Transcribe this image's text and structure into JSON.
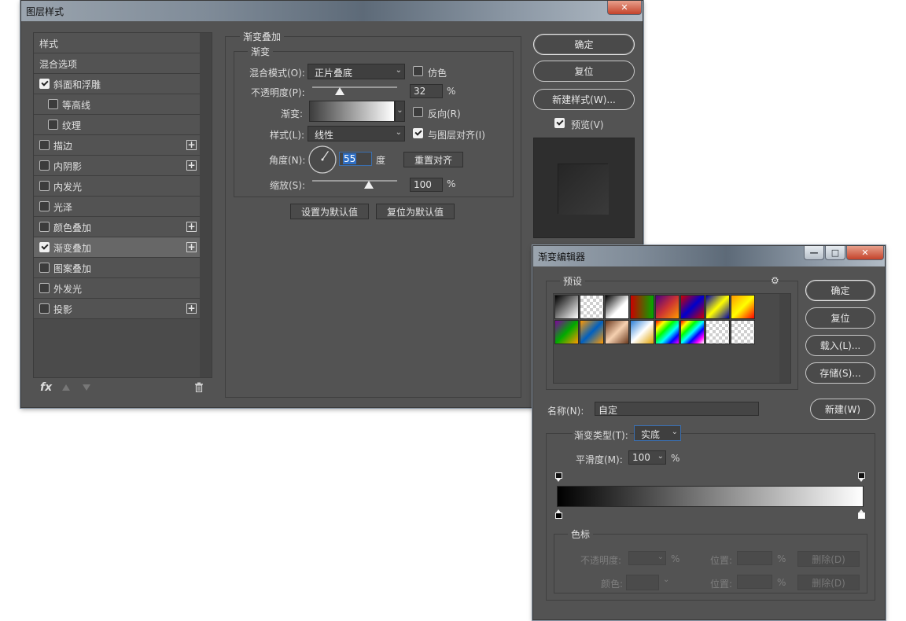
{
  "layer_style": {
    "title": "图层样式",
    "close_glyph": "✕",
    "styles": [
      {
        "label": "样式",
        "checkbox": false,
        "checked": false,
        "indent": false,
        "plus": false,
        "active": false
      },
      {
        "label": "混合选项",
        "checkbox": false,
        "checked": false,
        "indent": false,
        "plus": false,
        "active": false
      },
      {
        "label": "斜面和浮雕",
        "checkbox": true,
        "checked": true,
        "indent": false,
        "plus": false,
        "active": false
      },
      {
        "label": "等高线",
        "checkbox": true,
        "checked": false,
        "indent": true,
        "plus": false,
        "active": false
      },
      {
        "label": "纹理",
        "checkbox": true,
        "checked": false,
        "indent": true,
        "plus": false,
        "active": false
      },
      {
        "label": "描边",
        "checkbox": true,
        "checked": false,
        "indent": false,
        "plus": true,
        "active": false
      },
      {
        "label": "内阴影",
        "checkbox": true,
        "checked": false,
        "indent": false,
        "plus": true,
        "active": false
      },
      {
        "label": "内发光",
        "checkbox": true,
        "checked": false,
        "indent": false,
        "plus": false,
        "active": false
      },
      {
        "label": "光泽",
        "checkbox": true,
        "checked": false,
        "indent": false,
        "plus": false,
        "active": false
      },
      {
        "label": "颜色叠加",
        "checkbox": true,
        "checked": false,
        "indent": false,
        "plus": true,
        "active": false
      },
      {
        "label": "渐变叠加",
        "checkbox": true,
        "checked": true,
        "indent": false,
        "plus": true,
        "active": true
      },
      {
        "label": "图案叠加",
        "checkbox": true,
        "checked": false,
        "indent": false,
        "plus": false,
        "active": false
      },
      {
        "label": "外发光",
        "checkbox": true,
        "checked": false,
        "indent": false,
        "plus": false,
        "active": false
      },
      {
        "label": "投影",
        "checkbox": true,
        "checked": false,
        "indent": false,
        "plus": true,
        "active": false
      }
    ],
    "fx_label": "fx",
    "plus_glyph": "+",
    "panel": {
      "group_title": "渐变叠加",
      "sub_title": "渐变",
      "blend_mode_label": "混合模式(O):",
      "blend_mode_value": "正片叠底",
      "dither_label": "仿色",
      "opacity_label": "不透明度(P):",
      "opacity_value": "32",
      "opacity_level": 32,
      "percent": "%",
      "gradient_label": "渐变:",
      "reverse_label": "反向(R)",
      "style_label": "样式(L):",
      "style_value": "线性",
      "align_label": "与图层对齐(I)",
      "angle_label": "角度(N):",
      "angle_value": "55",
      "degree_label": "度",
      "reset_align_label": "重置对齐",
      "scale_label": "缩放(S):",
      "scale_value": "100",
      "scale_level": 100,
      "set_default_label": "设置为默认值",
      "reset_default_label": "复位为默认值"
    },
    "buttons": {
      "ok": "确定",
      "reset": "复位",
      "new_style": "新建样式(W)...",
      "preview": "预览(V)"
    }
  },
  "gradient_editor": {
    "title": "渐变编辑器",
    "presets_label": "预设",
    "gear_glyph": "⚙",
    "name_label": "名称(N):",
    "name_value": "自定",
    "new_button": "新建(W)",
    "buttons": {
      "ok": "确定",
      "reset": "复位",
      "load": "载入(L)...",
      "save": "存储(S)..."
    },
    "type_label": "渐变类型(T):",
    "type_value": "实底",
    "smooth_label": "平滑度(M):",
    "smooth_value": "100",
    "percent": "%",
    "stops_group": "色标",
    "opacity_label": "不透明度:",
    "location_label": "位置:",
    "delete_label": "删除(D)",
    "color_label": "颜色:",
    "arrow_glyph": "⌄",
    "window_glyphs": {
      "minimize": "—",
      "maximize": "□",
      "close": "✕"
    }
  }
}
